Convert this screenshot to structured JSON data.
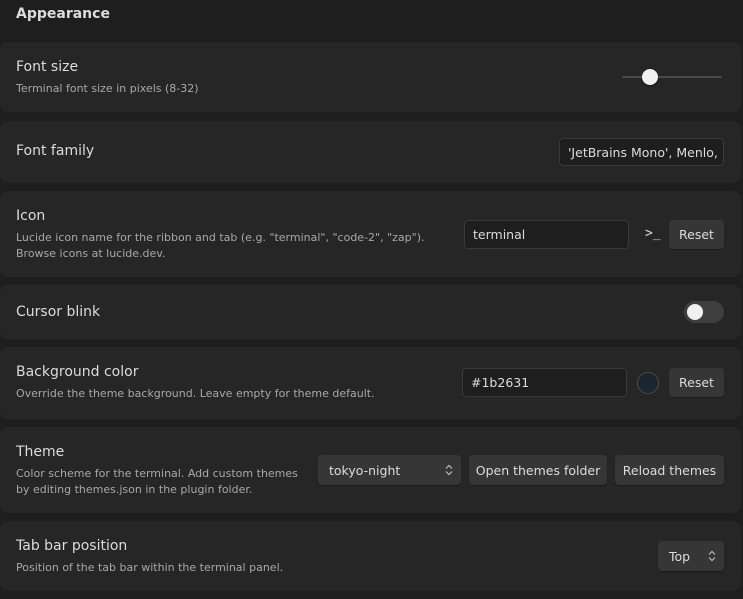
{
  "section": {
    "title": "Appearance"
  },
  "settings": {
    "font_size": {
      "name": "Font size",
      "desc": "Terminal font size in pixels (8-32)",
      "slider_fraction": 0.28
    },
    "font_family": {
      "name": "Font family",
      "value": "'JetBrains Mono', Menlo, Monaco, monospace"
    },
    "icon": {
      "name": "Icon",
      "desc": "Lucide icon name for the ribbon and tab (e.g. \"terminal\", \"code-2\", \"zap\"). Browse icons at lucide.dev.",
      "value": "terminal",
      "preview_icon": "terminal-icon",
      "preview_glyph": ">_",
      "reset_label": "Reset"
    },
    "cursor_blink": {
      "name": "Cursor blink",
      "enabled": false
    },
    "background_color": {
      "name": "Background color",
      "desc": "Override the theme background. Leave empty for theme default.",
      "value": "#1b2631",
      "swatch_color": "#1b2631",
      "reset_label": "Reset"
    },
    "theme": {
      "name": "Theme",
      "desc": "Color scheme for the terminal. Add custom themes by editing themes.json in the plugin folder.",
      "selected": "tokyo-night",
      "open_label": "Open themes folder",
      "reload_label": "Reload themes"
    },
    "tab_bar_position": {
      "name": "Tab bar position",
      "desc": "Position of the tab bar within the terminal panel.",
      "selected": "Top"
    }
  }
}
